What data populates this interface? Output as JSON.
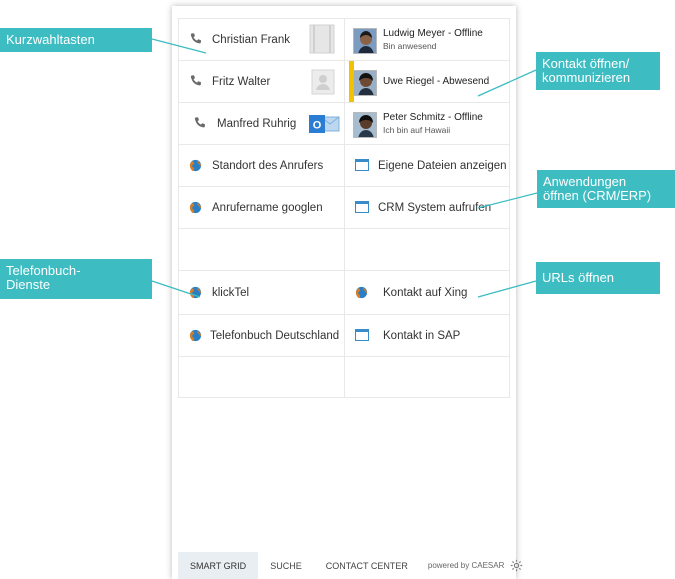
{
  "speed_dial": [
    {
      "name": "Christian Frank"
    },
    {
      "name": "Fritz Walter"
    },
    {
      "name": "Manfred Ruhrig"
    }
  ],
  "contacts": [
    {
      "name": "Ludwig Meyer - Offline",
      "status": "Bin anwesend",
      "status_color": "#ffffff"
    },
    {
      "name": "Uwe Riegel - Abwesend",
      "status": "",
      "status_color": "#f2c200"
    },
    {
      "name": "Peter Schmitz - Offline",
      "status": "Ich bin auf Hawaii",
      "status_color": "#ffffff"
    }
  ],
  "functions": {
    "caller_location": "Standort des Anrufers",
    "google_caller": "Anrufername googlen",
    "own_files": "Eigene Dateien anzeigen",
    "crm_system": "CRM System aufrufen",
    "klicktel": "klickTel",
    "xing": "Kontakt auf Xing",
    "telefonbuch": "Telefonbuch Deutschland",
    "sap": "Kontakt in SAP"
  },
  "tabs": [
    {
      "label": "SMART GRID",
      "active": true
    },
    {
      "label": "SUCHE",
      "active": false
    },
    {
      "label": "CONTACT CENTER",
      "active": false
    }
  ],
  "footer": {
    "powered": "powered by CAESAR"
  },
  "callouts": {
    "kurzwahl": "Kurzwahltasten",
    "kontakt_1": "Kontakt öffnen/",
    "kontakt_2": "kommunizieren",
    "anwendungen_1": "Anwendungen",
    "anwendungen_2": "öffnen (CRM/ERP)",
    "telefonbuch_1": "Telefonbuch-",
    "telefonbuch_2": "Dienste",
    "urls": "URLs öffnen"
  },
  "colors": {
    "accent": "#3dbcc2",
    "phone_icon": "#6a6a6a",
    "globe_blue": "#2a7fc4",
    "globe_orange": "#e07a1f",
    "window_icon": "#3a8cc8",
    "outlook_blue": "#2b7cd3"
  }
}
